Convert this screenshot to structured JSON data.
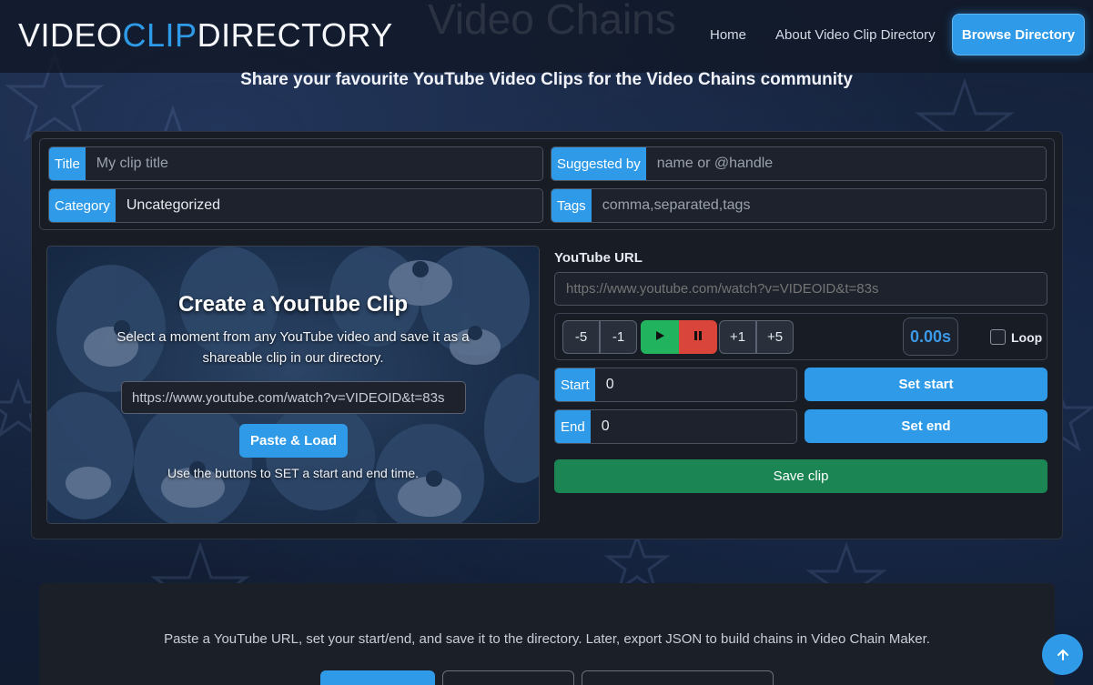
{
  "brand": {
    "part1": "VIDEO",
    "part2": "CLIP",
    "part3": "DIRECTORY"
  },
  "ghost_title": "Video Chains",
  "nav": {
    "home": "Home",
    "about": "About Video Clip Directory",
    "browse": "Browse Directory"
  },
  "subtitle": "Share your favourite YouTube Video Clips for the Video Chains community",
  "form": {
    "title_label": "Title",
    "title_placeholder": "My clip title",
    "suggested_label": "Suggested by",
    "suggested_placeholder": "name or @handle",
    "category_label": "Category",
    "category_value": "Uncategorized",
    "tags_label": "Tags",
    "tags_placeholder": "comma,separated,tags"
  },
  "hero": {
    "title": "Create a YouTube Clip",
    "text": "Select a moment from any YouTube video and save it as a shareable clip in our directory.",
    "input_value": "https://www.youtube.com/watch?v=VIDEOID&t=83s",
    "button": "Paste & Load",
    "hint": "Use the buttons to SET a start and end time."
  },
  "player": {
    "url_label": "YouTube URL",
    "url_placeholder": "https://www.youtube.com/watch?v=VIDEOID&t=83s",
    "back5": "-5",
    "back1": "-1",
    "fwd1": "+1",
    "fwd5": "+5",
    "time": "0.00s",
    "loop_label": "Loop",
    "start_label": "Start",
    "start_value": "0",
    "set_start": "Set start",
    "end_label": "End",
    "end_value": "0",
    "set_end": "Set end",
    "save": "Save clip"
  },
  "lower": {
    "text": "Paste a YouTube URL, set your start/end, and save it to the directory. Later, export JSON to build chains in Video Chain Maker."
  },
  "colors": {
    "accent": "#2f9be8",
    "play": "#22b35e",
    "pause": "#d9453a",
    "save": "#1b8553"
  },
  "icons": {
    "play": "play-icon",
    "pause": "pause-icon",
    "scroll_top": "arrow-up-icon"
  }
}
